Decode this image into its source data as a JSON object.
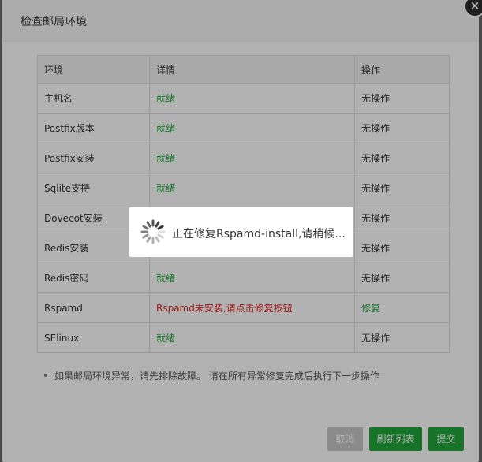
{
  "dialog": {
    "title": "检查邮局环境",
    "close_icon": "×"
  },
  "table": {
    "headers": [
      "环境",
      "详情",
      "操作"
    ],
    "rows": [
      {
        "env": "主机名",
        "detail": "就绪",
        "status": "ok",
        "action": "无操作"
      },
      {
        "env": "Postfix版本",
        "detail": "就绪",
        "status": "ok",
        "action": "无操作"
      },
      {
        "env": "Postfix安装",
        "detail": "就绪",
        "status": "ok",
        "action": "无操作"
      },
      {
        "env": "Sqlite支持",
        "detail": "就绪",
        "status": "ok",
        "action": "无操作"
      },
      {
        "env": "Dovecot安装",
        "detail": "",
        "status": "ok",
        "action": "无操作"
      },
      {
        "env": "Redis安装",
        "detail": "",
        "status": "ok",
        "action": "无操作"
      },
      {
        "env": "Redis密码",
        "detail": "就绪",
        "status": "ok",
        "action": "无操作"
      },
      {
        "env": "Rspamd",
        "detail": "Rspamd未安装,请点击修复按钮",
        "status": "error",
        "action": "修复"
      },
      {
        "env": "SElinux",
        "detail": "就绪",
        "status": "ok",
        "action": "无操作"
      }
    ]
  },
  "note": "如果邮局环境异常，请先排除故障。 请在所有异常修复完成后执行下一步操作",
  "buttons": {
    "cancel": "取消",
    "refresh": "刷新列表",
    "submit": "提交"
  },
  "loading": {
    "text": "正在修复Rspamd-install,请稍候..."
  },
  "colors": {
    "ok": "#20a53a",
    "error": "#e02020",
    "primary_button": "#20a53a",
    "disabled_button": "#c8c8c8"
  }
}
